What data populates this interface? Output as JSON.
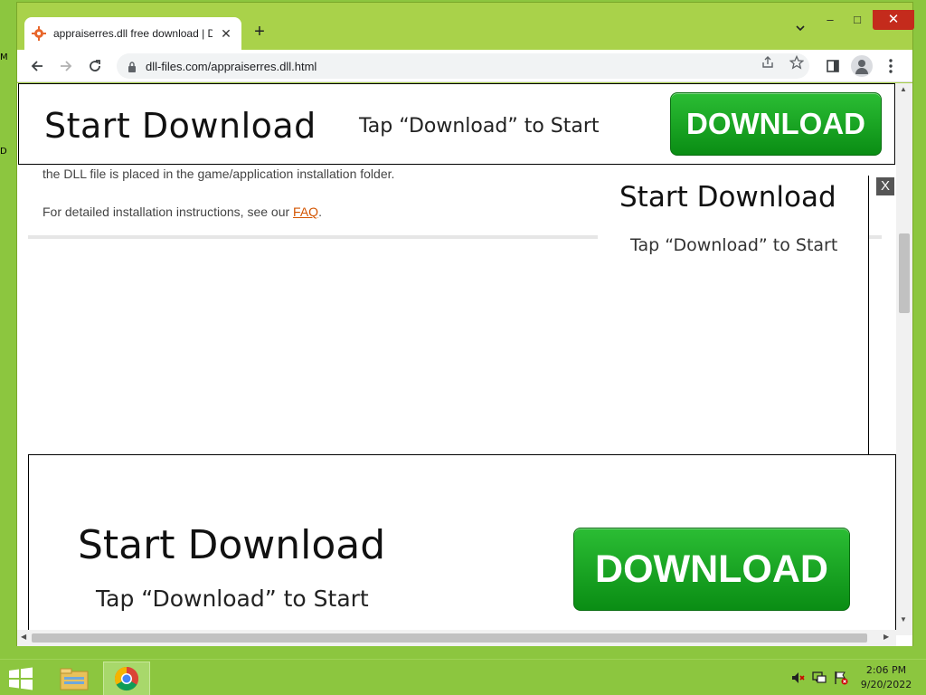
{
  "desktop": {
    "marks": [
      "M",
      "D"
    ]
  },
  "browser": {
    "tab": {
      "title": "appraiserres.dll free download | D",
      "favicon": "gear-favicon-icon",
      "close": "✕"
    },
    "new_tab": "+",
    "window_controls": {
      "minimize": "–",
      "maximize": "□",
      "close": "✕"
    },
    "address": {
      "url": "dll-files.com/appraiserres.dll.html"
    },
    "icons": [
      "back-icon",
      "forward-icon",
      "reload-icon",
      "lock-icon",
      "share-icon",
      "star-icon",
      "side-panel-icon",
      "profile-icon",
      "menu-icon"
    ]
  },
  "page": {
    "top_banner": {
      "heading": "Start Download",
      "subtext": "Tap “Download” to Start",
      "button": "DOWNLOAD"
    },
    "article": {
      "line1": "the DLL file is placed in the game/application installation folder.",
      "line2_prefix": "For detailed installation instructions, see our ",
      "line2_link": "FAQ",
      "line2_suffix": "."
    },
    "side_ad": {
      "heading": "Start Download",
      "subtext": "Tap “Download” to Start",
      "close": "X"
    },
    "bottom_banner": {
      "heading": "Start Download",
      "subtext": "Tap “Download” to Start",
      "button": "DOWNLOAD"
    }
  },
  "colors": {
    "accent_green": "#0a8d14",
    "link": "#d35400",
    "desktop": "#8cc63f"
  },
  "taskbar": {
    "apps": [
      "file-explorer-icon",
      "chrome-icon"
    ],
    "tray": [
      "volume-muted-icon",
      "network-icon",
      "action-center-flag-icon"
    ],
    "time": "2:06 PM",
    "date": "9/20/2022"
  }
}
